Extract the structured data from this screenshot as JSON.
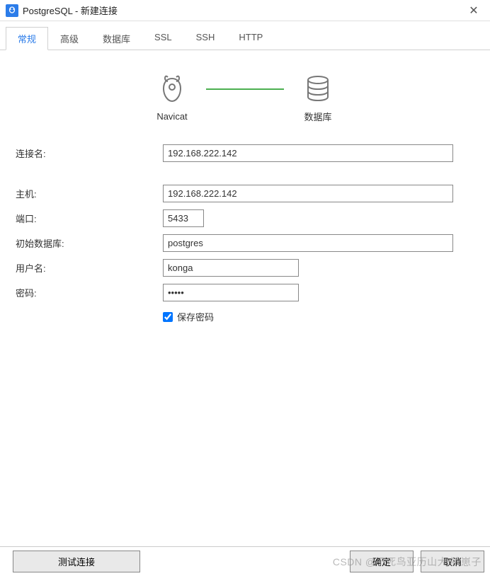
{
  "titlebar": {
    "title": "PostgreSQL - 新建连接"
  },
  "tabs": {
    "items": [
      {
        "label": "常规"
      },
      {
        "label": "高级"
      },
      {
        "label": "数据库"
      },
      {
        "label": "SSL"
      },
      {
        "label": "SSH"
      },
      {
        "label": "HTTP"
      }
    ],
    "active_index": 0
  },
  "diagram": {
    "left_label": "Navicat",
    "right_label": "数据库"
  },
  "form": {
    "connection_name": {
      "label": "连接名:",
      "value": "192.168.222.142"
    },
    "host": {
      "label": "主机:",
      "value": "192.168.222.142"
    },
    "port": {
      "label": "端口:",
      "value": "5433"
    },
    "initial_db": {
      "label": "初始数据库:",
      "value": "postgres"
    },
    "username": {
      "label": "用户名:",
      "value": "konga"
    },
    "password": {
      "label": "密码:",
      "value": "•••••"
    },
    "save_password": {
      "label": "保存密码",
      "checked": true
    }
  },
  "footer": {
    "test_label": "测试连接",
    "ok_label": "确定",
    "cancel_label": "取消"
  },
  "watermark": "CSDN @不死鸟亚历山大.狼崽子"
}
